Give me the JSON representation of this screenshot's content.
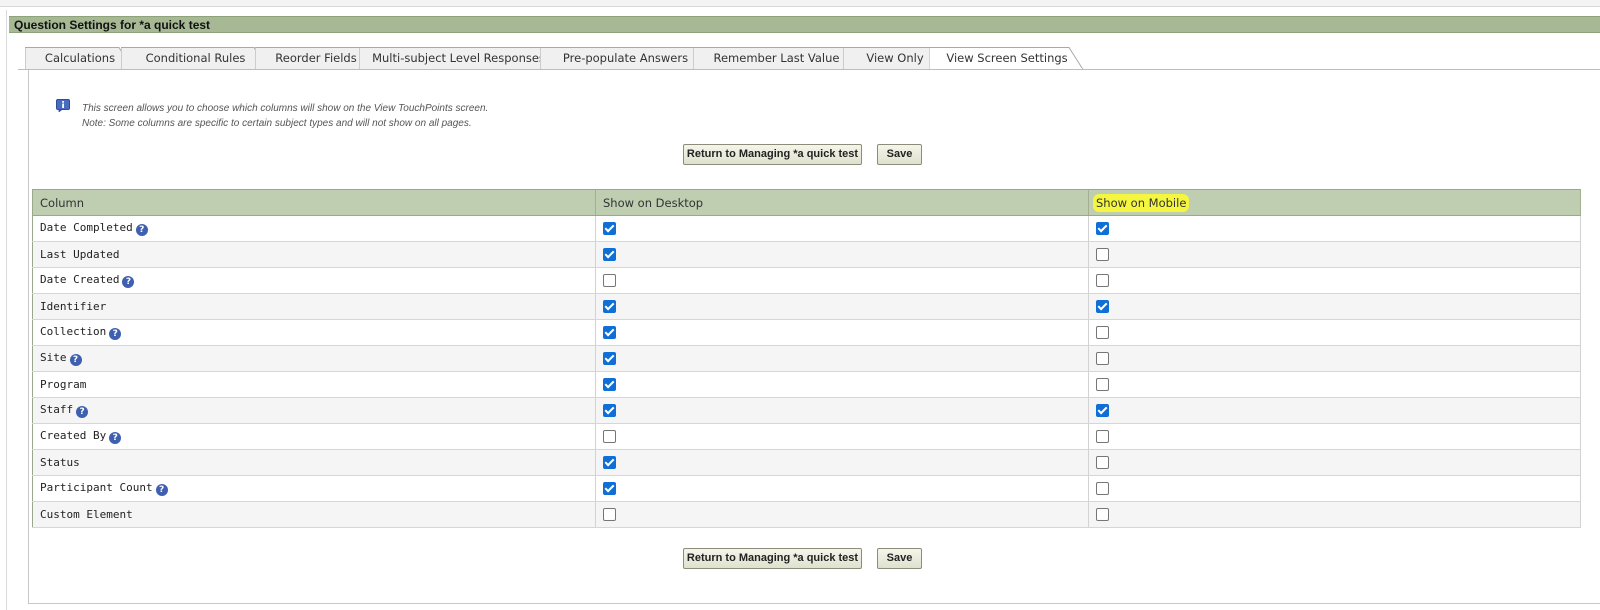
{
  "page_title": "Question Settings for *a quick test",
  "tabs": [
    {
      "label": "Calculations",
      "active": false
    },
    {
      "label": "Conditional Rules",
      "active": false
    },
    {
      "label": "Reorder Fields",
      "active": false
    },
    {
      "label": "Multi-subject Level Responses",
      "active": false
    },
    {
      "label": "Pre-populate Answers",
      "active": false
    },
    {
      "label": "Remember Last Value",
      "active": false
    },
    {
      "label": "View Only",
      "active": false
    },
    {
      "label": "View Screen Settings",
      "active": true
    }
  ],
  "info": {
    "line1": "This screen allows you to choose which columns will show on the View TouchPoints screen.",
    "line2": "Note: Some columns are specific to certain subject types and will not show on all pages."
  },
  "buttons": {
    "return_label": "Return to Managing *a quick test",
    "save_label": "Save"
  },
  "table": {
    "headers": [
      "Column",
      "Show on Desktop",
      "Show on Mobile"
    ],
    "rows": [
      {
        "label": "Date Completed",
        "help": true,
        "desktop": true,
        "mobile": true
      },
      {
        "label": "Last Updated",
        "help": false,
        "desktop": true,
        "mobile": false
      },
      {
        "label": "Date Created",
        "help": true,
        "desktop": false,
        "mobile": false
      },
      {
        "label": "Identifier",
        "help": false,
        "desktop": true,
        "mobile": true
      },
      {
        "label": "Collection",
        "help": true,
        "desktop": true,
        "mobile": false
      },
      {
        "label": "Site",
        "help": true,
        "desktop": true,
        "mobile": false
      },
      {
        "label": "Program",
        "help": false,
        "desktop": true,
        "mobile": false
      },
      {
        "label": "Staff",
        "help": true,
        "desktop": true,
        "mobile": true
      },
      {
        "label": "Created By",
        "help": true,
        "desktop": false,
        "mobile": false
      },
      {
        "label": "Status",
        "help": false,
        "desktop": true,
        "mobile": false
      },
      {
        "label": "Participant Count",
        "help": true,
        "desktop": true,
        "mobile": false
      },
      {
        "label": "Custom Element",
        "help": false,
        "desktop": false,
        "mobile": false
      }
    ]
  },
  "icons": {
    "info": "info-icon",
    "help": "help-icon"
  },
  "colors": {
    "title_bar": "#a7b895",
    "header_row": "#bfcdb0",
    "checkbox_checked": "#0f6fd6",
    "highlight": "#f4f640"
  }
}
